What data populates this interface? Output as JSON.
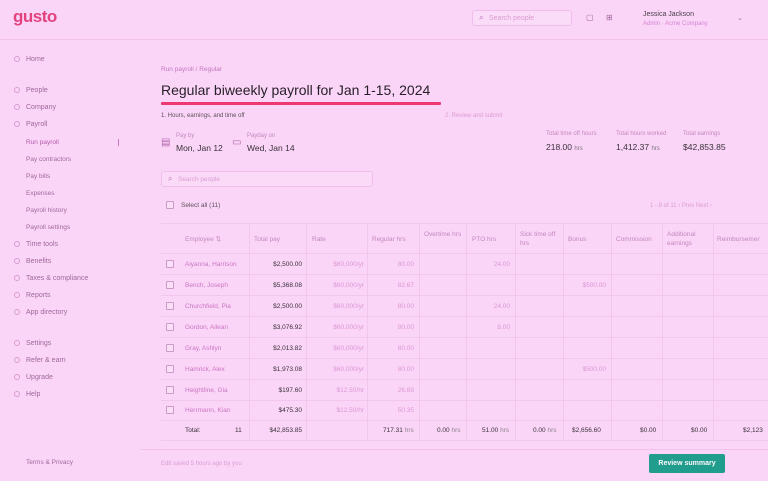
{
  "app": {
    "logo": "gusto"
  },
  "topbar": {
    "search_placeholder": "Search people",
    "user_name": "Jessica Jackson",
    "user_company": "Admin · Acme Company"
  },
  "sidebar": {
    "items": [
      {
        "label": "Home"
      },
      {
        "label": "People"
      },
      {
        "label": "Company"
      },
      {
        "label": "Payroll"
      },
      {
        "label": "Run payroll"
      },
      {
        "label": "Pay contractors"
      },
      {
        "label": "Pay bills"
      },
      {
        "label": "Expenses"
      },
      {
        "label": "Payroll history"
      },
      {
        "label": "Payroll settings"
      },
      {
        "label": "Time tools"
      },
      {
        "label": "Benefits"
      },
      {
        "label": "Taxes & compliance"
      },
      {
        "label": "Reports"
      },
      {
        "label": "App directory"
      },
      {
        "label": "Settings"
      },
      {
        "label": "Refer & earn"
      },
      {
        "label": "Upgrade"
      },
      {
        "label": "Help"
      }
    ],
    "footer": "Terms & Privacy"
  },
  "main": {
    "breadcrumb": "Run payroll / Regular",
    "title": "Regular biweekly payroll for Jan 1-15, 2024",
    "step": "1. Hours, earnings, and time off",
    "review_link": "2. Review and submit",
    "pay_by_label": "Pay by",
    "pay_by_value": "Mon, Jan 12",
    "payday_label": "Payday on",
    "payday_value": "Wed, Jan 14",
    "stats": [
      {
        "label": "Total time off hours",
        "value": "218.00",
        "unit": "hrs"
      },
      {
        "label": "Total hours worked",
        "value": "1,412.37",
        "unit": "hrs"
      },
      {
        "label": "Total earnings",
        "value": "$42,853.85",
        "unit": ""
      }
    ],
    "search_placeholder": "Search people",
    "select_all": "Select all (11)",
    "pager": "1 - 8 of 11   ‹ Prev  Next ›"
  },
  "table": {
    "headers": [
      "Employee ⇅",
      "Total pay",
      "Rate",
      "Regular hrs",
      "Overtime hrs",
      "PTO hrs",
      "Sick time off hrs",
      "Bonus",
      "Commission",
      "Additional earnings",
      "Reimbursemer"
    ],
    "rows": [
      {
        "name": "Aiyanna, Harrison",
        "total": "$2,500.00",
        "rate": "$60,000/yr",
        "reg": "80.00",
        "ot": "",
        "pto": "24.00",
        "sick": "",
        "bonus": ""
      },
      {
        "name": "Bench, Joseph",
        "total": "$5,368.08",
        "rate": "$60,000/yr",
        "reg": "82.67",
        "ot": "",
        "pto": "",
        "sick": "",
        "bonus": "$500.00"
      },
      {
        "name": "Churchfield, Pia",
        "total": "$2,500.00",
        "rate": "$60,000/yr",
        "reg": "80.00",
        "ot": "",
        "pto": "24.00",
        "sick": "",
        "bonus": ""
      },
      {
        "name": "Gordon, Ailean",
        "total": "$3,076.92",
        "rate": "$60,000/yr",
        "reg": "80.00",
        "ot": "",
        "pto": "8.00",
        "sick": "",
        "bonus": ""
      },
      {
        "name": "Gray, Ashlyn",
        "total": "$2,013.82",
        "rate": "$60,000/yr",
        "reg": "80.00",
        "ot": "",
        "pto": "",
        "sick": "",
        "bonus": ""
      },
      {
        "name": "Hamrick, Alex",
        "total": "$1,973.08",
        "rate": "$60,000/yr",
        "reg": "80.00",
        "ot": "",
        "pto": "",
        "sick": "",
        "bonus": "$500.00"
      },
      {
        "name": "Heightline, Gia",
        "total": "$197.60",
        "rate": "$12.50/hr",
        "reg": "26.88",
        "ot": "",
        "pto": "",
        "sick": "",
        "bonus": ""
      },
      {
        "name": "Herrmann, Kian",
        "total": "$475.30",
        "rate": "$12.50/hr",
        "reg": "50.35",
        "ot": "",
        "pto": "",
        "sick": "",
        "bonus": ""
      }
    ],
    "totals": {
      "label": "Total:",
      "count": "11",
      "total": "$42,853.85",
      "reg": "717.31",
      "reg_unit": "hrs",
      "ot": "0.00",
      "ot_unit": "hrs",
      "pto": "51.00",
      "pto_unit": "hrs",
      "sick": "0.00",
      "sick_unit": "hrs",
      "bonus": "$2,656.60",
      "commission": "$0.00",
      "additional": "$0.00",
      "reimb": "$2,123"
    }
  },
  "footer": {
    "saved": "Edit saved 5 hours ago by you",
    "review_button": "Review summary"
  },
  "colors": {
    "brand": "#e2467a",
    "underline": "#ed3a6e",
    "button": "#1aa38a"
  }
}
